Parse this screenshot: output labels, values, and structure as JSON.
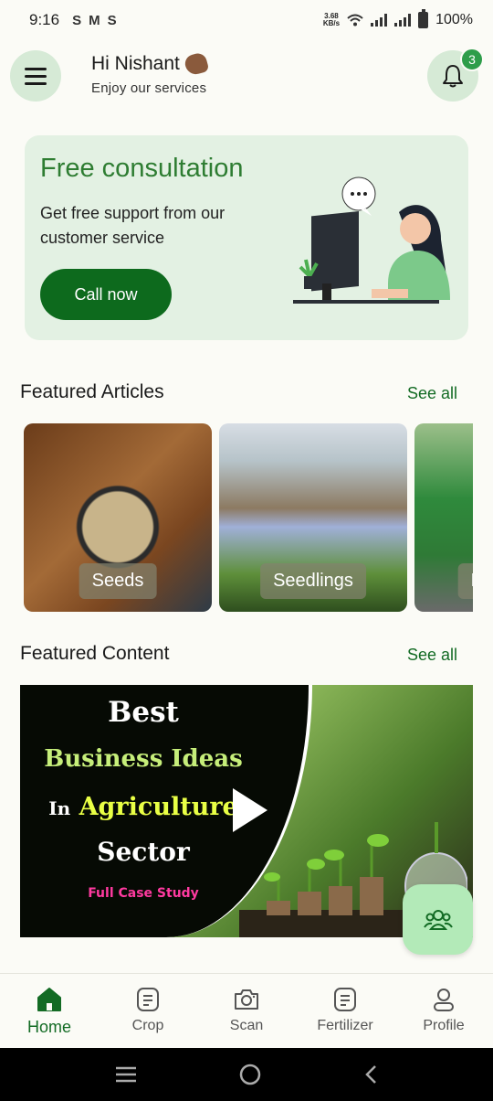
{
  "status_bar": {
    "time": "9:16",
    "notif_icons": [
      "S",
      "M",
      "S"
    ],
    "net_speed_value": "3.68",
    "net_speed_unit": "KB/s",
    "battery": "100%"
  },
  "header": {
    "greeting": "Hi Nishant",
    "subtitle": "Enjoy our services",
    "notification_count": "3"
  },
  "consultation": {
    "title": "Free consultation",
    "description": "Get free support from our customer service",
    "button_label": "Call now"
  },
  "featured_articles": {
    "title": "Featured Articles",
    "see_all": "See all",
    "items": [
      {
        "label": "Seeds"
      },
      {
        "label": "Seedlings"
      },
      {
        "label": "M"
      }
    ]
  },
  "featured_content": {
    "title": "Featured Content",
    "see_all": "See all",
    "video": {
      "line1": "Best",
      "line2": "Business Ideas",
      "line3_prefix": "In",
      "line3_highlight": "Agriculture",
      "line4": "Sector",
      "line5": "Full Case Study"
    }
  },
  "bottom_nav": {
    "items": [
      {
        "label": "Home",
        "icon": "home-icon",
        "active": true
      },
      {
        "label": "Crop",
        "icon": "crop-icon"
      },
      {
        "label": "Scan",
        "icon": "camera-icon"
      },
      {
        "label": "Fertilizer",
        "icon": "fertilizer-icon"
      },
      {
        "label": "Profile",
        "icon": "profile-icon"
      }
    ]
  },
  "colors": {
    "primary": "#0d6a1d",
    "accent_text": "#2e7d32",
    "card_bg": "#e3f1e3",
    "fab_bg": "#b3eab8"
  }
}
